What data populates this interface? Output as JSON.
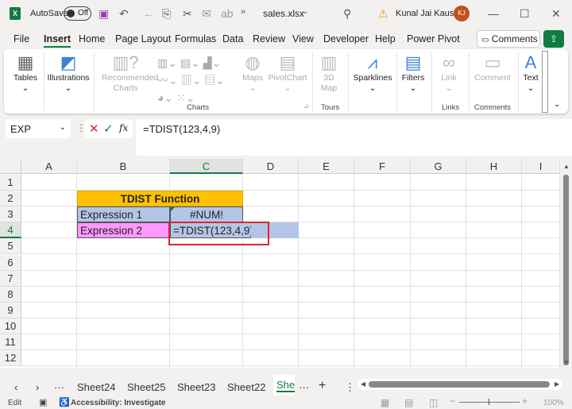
{
  "titlebar": {
    "app_icon": "excel-icon",
    "autosave_label": "AutoSave",
    "autosave_state": "Off",
    "filename": "sales.xlsx",
    "user_name": "Kunal Jai Kaushik",
    "user_initials": "KJ"
  },
  "menu": {
    "items": [
      "File",
      "Insert",
      "Home",
      "Page Layout",
      "Formulas",
      "Data",
      "Review",
      "View",
      "Developer",
      "Help",
      "Power Pivot"
    ],
    "active": "Insert",
    "comments_label": "Comments"
  },
  "ribbon": {
    "tables": "Tables",
    "illustrations": "Illustrations",
    "recommended_charts": "Recommended Charts",
    "maps": "Maps",
    "pivotchart": "PivotChart",
    "map3d": "3D Map",
    "sparklines": "Sparklines",
    "filters": "Filters",
    "link": "Link",
    "comment": "Comment",
    "text": "Text",
    "groups": {
      "charts": "Charts",
      "tours": "Tours",
      "links": "Links",
      "comments": "Comments"
    }
  },
  "formula_bar": {
    "name_box": "EXP",
    "formula": "=TDIST(123,4,9)",
    "fx": "fx"
  },
  "columns": [
    "A",
    "B",
    "C",
    "D",
    "E",
    "F",
    "G",
    "H",
    "I"
  ],
  "rows": [
    "1",
    "2",
    "3",
    "4",
    "5",
    "6",
    "7",
    "8",
    "9",
    "10",
    "11",
    "12"
  ],
  "cells": {
    "B2": "TDIST Function",
    "B3": "Expression 1",
    "C3": "#NUM!",
    "B4": "Expression 2",
    "C4": "=TDIST(123,4,9)"
  },
  "colors": {
    "header_fill": "#ffc000",
    "expr1_fill": "#b4c6e7",
    "expr2_fill": "#ff99ff",
    "highlight_border": "#d9262e",
    "accent": "#107c41"
  },
  "sheet_tabs": [
    "Sheet24",
    "Sheet25",
    "Sheet23",
    "Sheet22",
    "Shee"
  ],
  "active_sheet": "Shee",
  "status": {
    "mode": "Edit",
    "accessibility": "Accessibility: Investigate",
    "zoom": "100%"
  }
}
